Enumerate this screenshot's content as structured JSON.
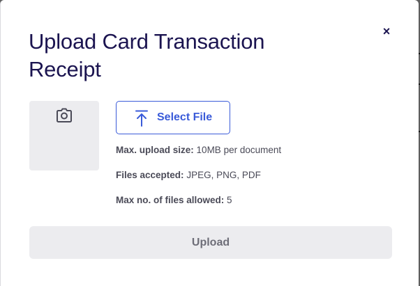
{
  "modal": {
    "title": "Upload Card Transaction Receipt",
    "close_symbol": "×"
  },
  "preview": {
    "icon": "camera-icon"
  },
  "select_file": {
    "label": "Select File",
    "icon": "upload-arrow-icon",
    "accent": "#3a5bd9"
  },
  "info": {
    "max_size_label": "Max. upload size:",
    "max_size_value": "10MB per document",
    "files_accepted_label": "Files accepted:",
    "files_accepted_value": "JPEG, PNG, PDF",
    "max_files_label": "Max no. of files allowed:",
    "max_files_value": "5"
  },
  "upload_button": {
    "label": "Upload",
    "state": "disabled"
  },
  "colors": {
    "title": "#1b1450",
    "disabled_bg": "#ececef",
    "disabled_text": "#6e6e78"
  }
}
